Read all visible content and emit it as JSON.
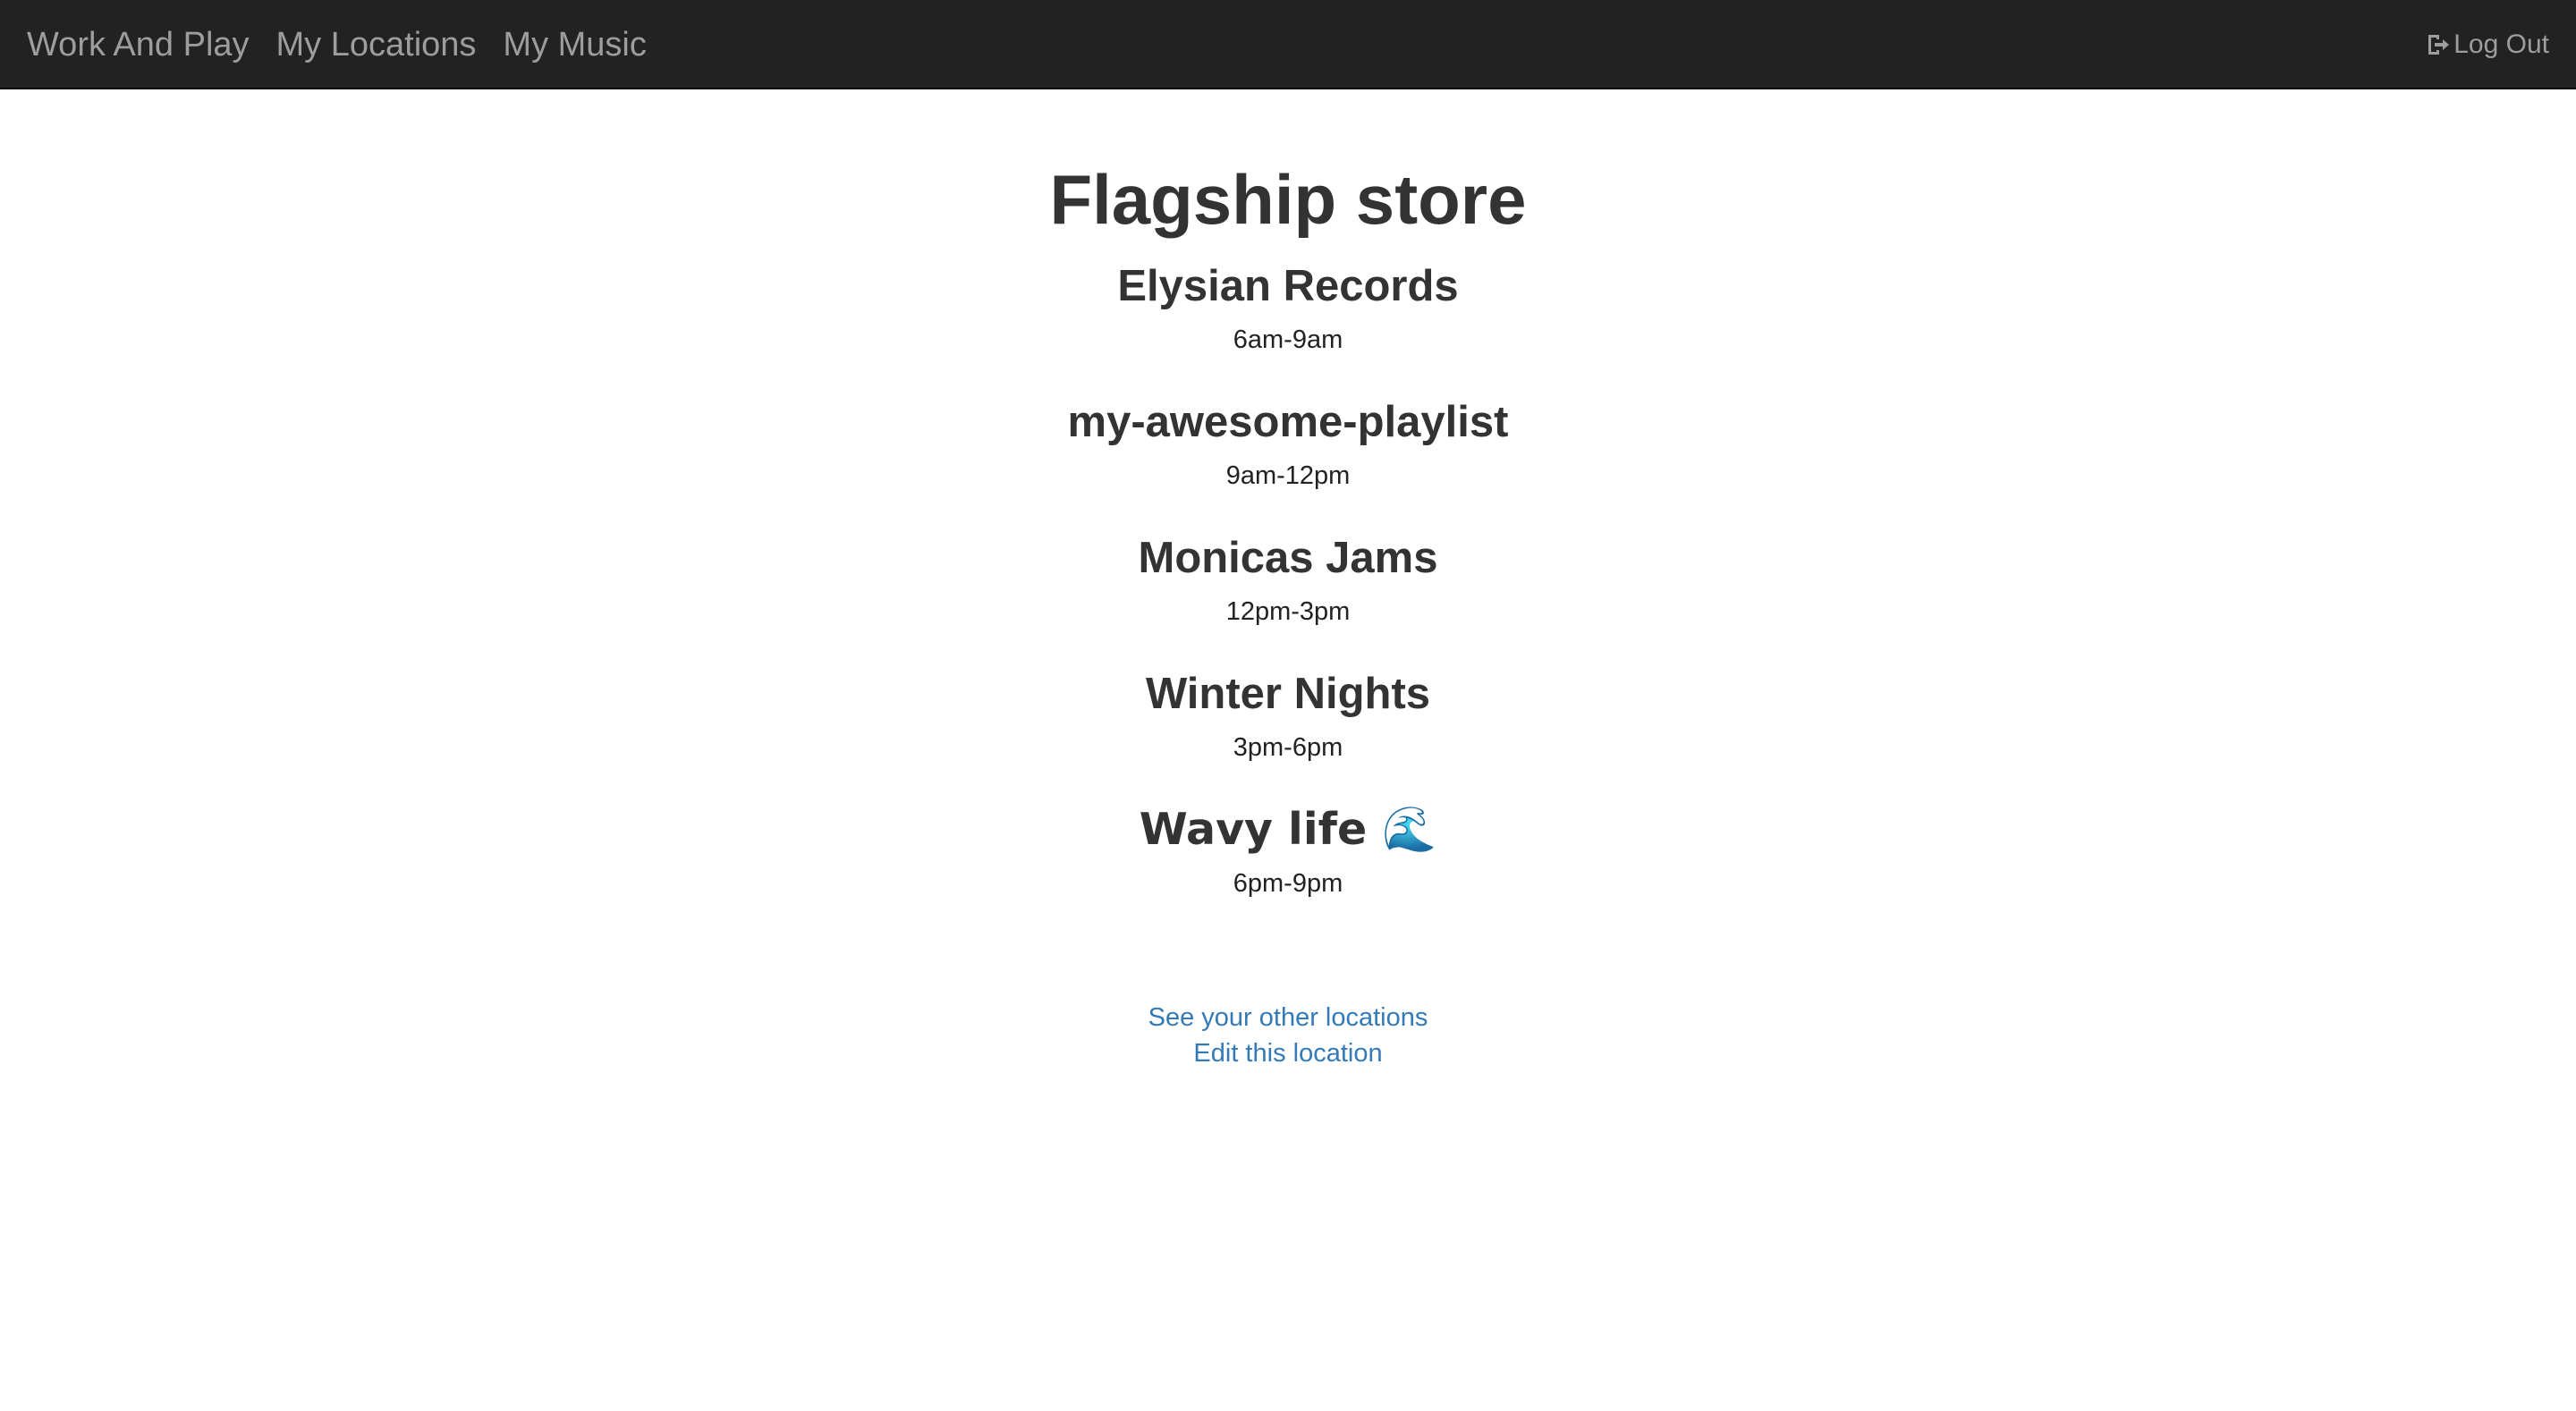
{
  "navbar": {
    "brand": "Work And Play",
    "links": [
      "My Locations",
      "My Music"
    ],
    "logout_label": "Log Out"
  },
  "page": {
    "title": "Flagship store"
  },
  "schedule": [
    {
      "name": "Elysian Records",
      "time": "6am-9am"
    },
    {
      "name": "my-awesome-playlist",
      "time": "9am-12pm"
    },
    {
      "name": "Monicas Jams",
      "time": "12pm-3pm"
    },
    {
      "name": "Winter Nights",
      "time": "3pm-6pm"
    },
    {
      "name": "Wavy life 🌊",
      "time": "6pm-9pm"
    }
  ],
  "footer_links": {
    "other_locations": "See your other locations",
    "edit_location": "Edit this location"
  },
  "colors": {
    "navbar_bg": "#222222",
    "nav_text": "#9d9d9d",
    "link": "#337ab7",
    "heading": "#333333"
  }
}
